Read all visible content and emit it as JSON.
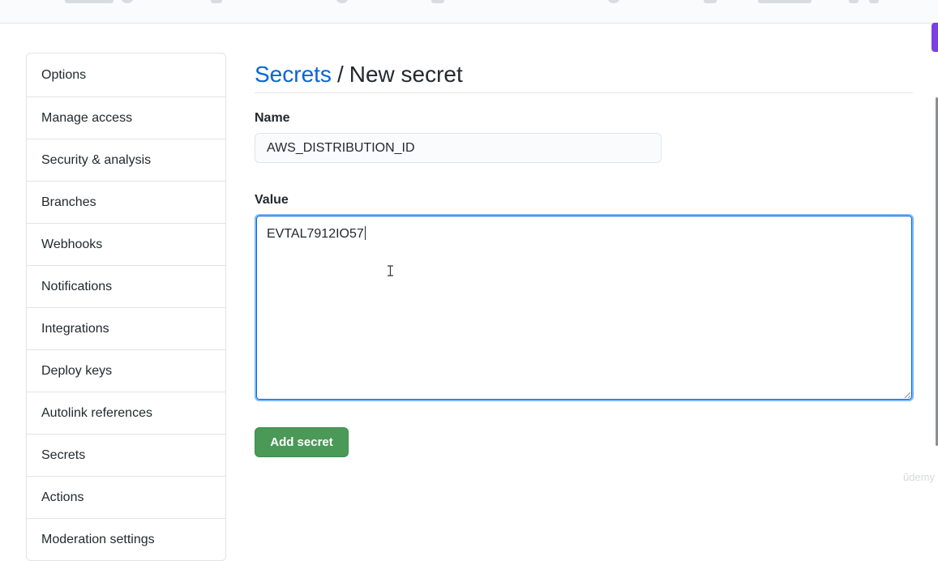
{
  "sidebar": {
    "items": [
      {
        "label": "Options"
      },
      {
        "label": "Manage access"
      },
      {
        "label": "Security & analysis"
      },
      {
        "label": "Branches"
      },
      {
        "label": "Webhooks"
      },
      {
        "label": "Notifications"
      },
      {
        "label": "Integrations"
      },
      {
        "label": "Deploy keys"
      },
      {
        "label": "Autolink references"
      },
      {
        "label": "Secrets"
      },
      {
        "label": "Actions"
      },
      {
        "label": "Moderation settings"
      }
    ]
  },
  "header": {
    "breadcrumb_link": "Secrets",
    "separator": "/",
    "current": "New secret"
  },
  "form": {
    "name_label": "Name",
    "name_value": "AWS_DISTRIBUTION_ID",
    "value_label": "Value",
    "value_text": "EVTAL7912IO57",
    "submit_label": "Add secret"
  },
  "watermark": "ûdemy",
  "colors": {
    "link": "#0366d6",
    "button": "#4a9957",
    "focus": "#79b8ff",
    "accent_tab": "#7c3fe4"
  }
}
